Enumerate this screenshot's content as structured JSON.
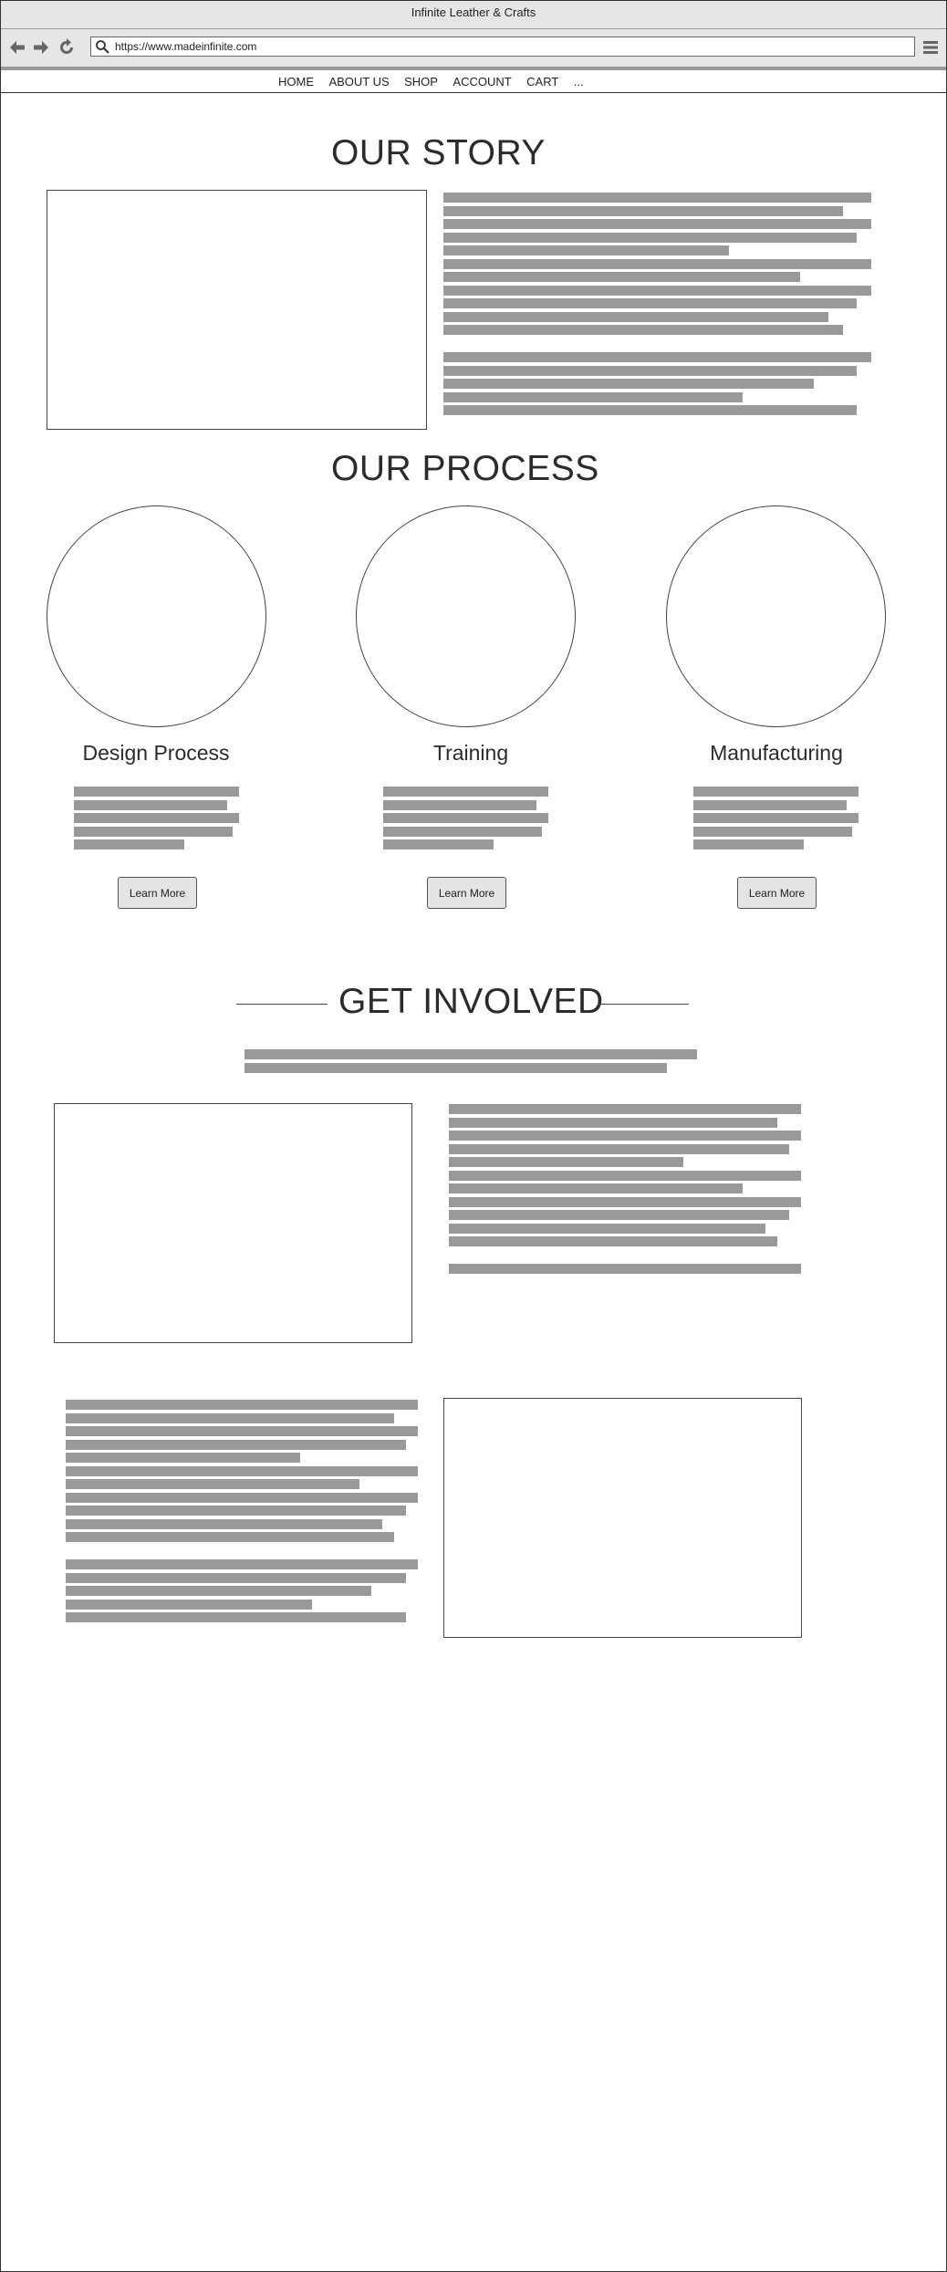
{
  "window": {
    "title": "Infinite Leather & Crafts"
  },
  "browser": {
    "url": "https://www.madeinfinite.com"
  },
  "nav": {
    "items": [
      "HOME",
      "ABOUT US",
      "SHOP",
      "ACCOUNT",
      "CART",
      "..."
    ]
  },
  "story": {
    "heading": "OUR STORY"
  },
  "process": {
    "heading": "OUR PROCESS",
    "items": [
      {
        "title": "Design Process",
        "button": "Learn More"
      },
      {
        "title": "Training",
        "button": "Learn More"
      },
      {
        "title": "Manufacturing",
        "button": "Learn More"
      }
    ]
  },
  "involved": {
    "heading": "GET INVOLVED"
  }
}
